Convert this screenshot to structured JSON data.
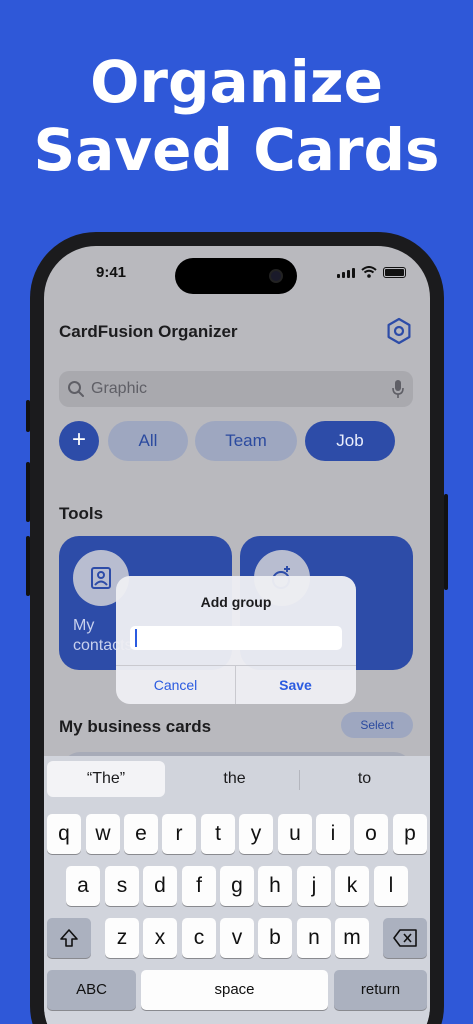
{
  "headline": {
    "line1": "Organize",
    "line2": "Saved Cards"
  },
  "status": {
    "time": "9:41"
  },
  "app": {
    "title": "CardFusion Organizer"
  },
  "search": {
    "placeholder": "Graphic"
  },
  "filters": {
    "add_label": "+",
    "items": [
      "All",
      "Team",
      "Job"
    ],
    "selected": "Job"
  },
  "tools": {
    "heading": "Tools",
    "card1_label": "My contacts"
  },
  "cards": {
    "heading": "My business cards",
    "select_label": "Select"
  },
  "dialog": {
    "title": "Add group",
    "input_value": "",
    "cancel_label": "Cancel",
    "save_label": "Save"
  },
  "keyboard": {
    "suggestions": [
      "“The”",
      "the",
      "to"
    ],
    "row1": [
      "q",
      "w",
      "e",
      "r",
      "t",
      "y",
      "u",
      "i",
      "o",
      "p"
    ],
    "row2": [
      "a",
      "s",
      "d",
      "f",
      "g",
      "h",
      "j",
      "k",
      "l"
    ],
    "row3": [
      "z",
      "x",
      "c",
      "v",
      "b",
      "n",
      "m"
    ],
    "abc_label": "ABC",
    "space_label": "space",
    "return_label": "return"
  },
  "colors": {
    "background": "#2f58d8",
    "accent": "#2d4ca8",
    "link": "#2b5be0"
  },
  "icons": {
    "settings": "gear-icon",
    "search": "search-icon",
    "mic": "mic-icon",
    "shift": "shift-icon",
    "delete": "delete-icon"
  }
}
